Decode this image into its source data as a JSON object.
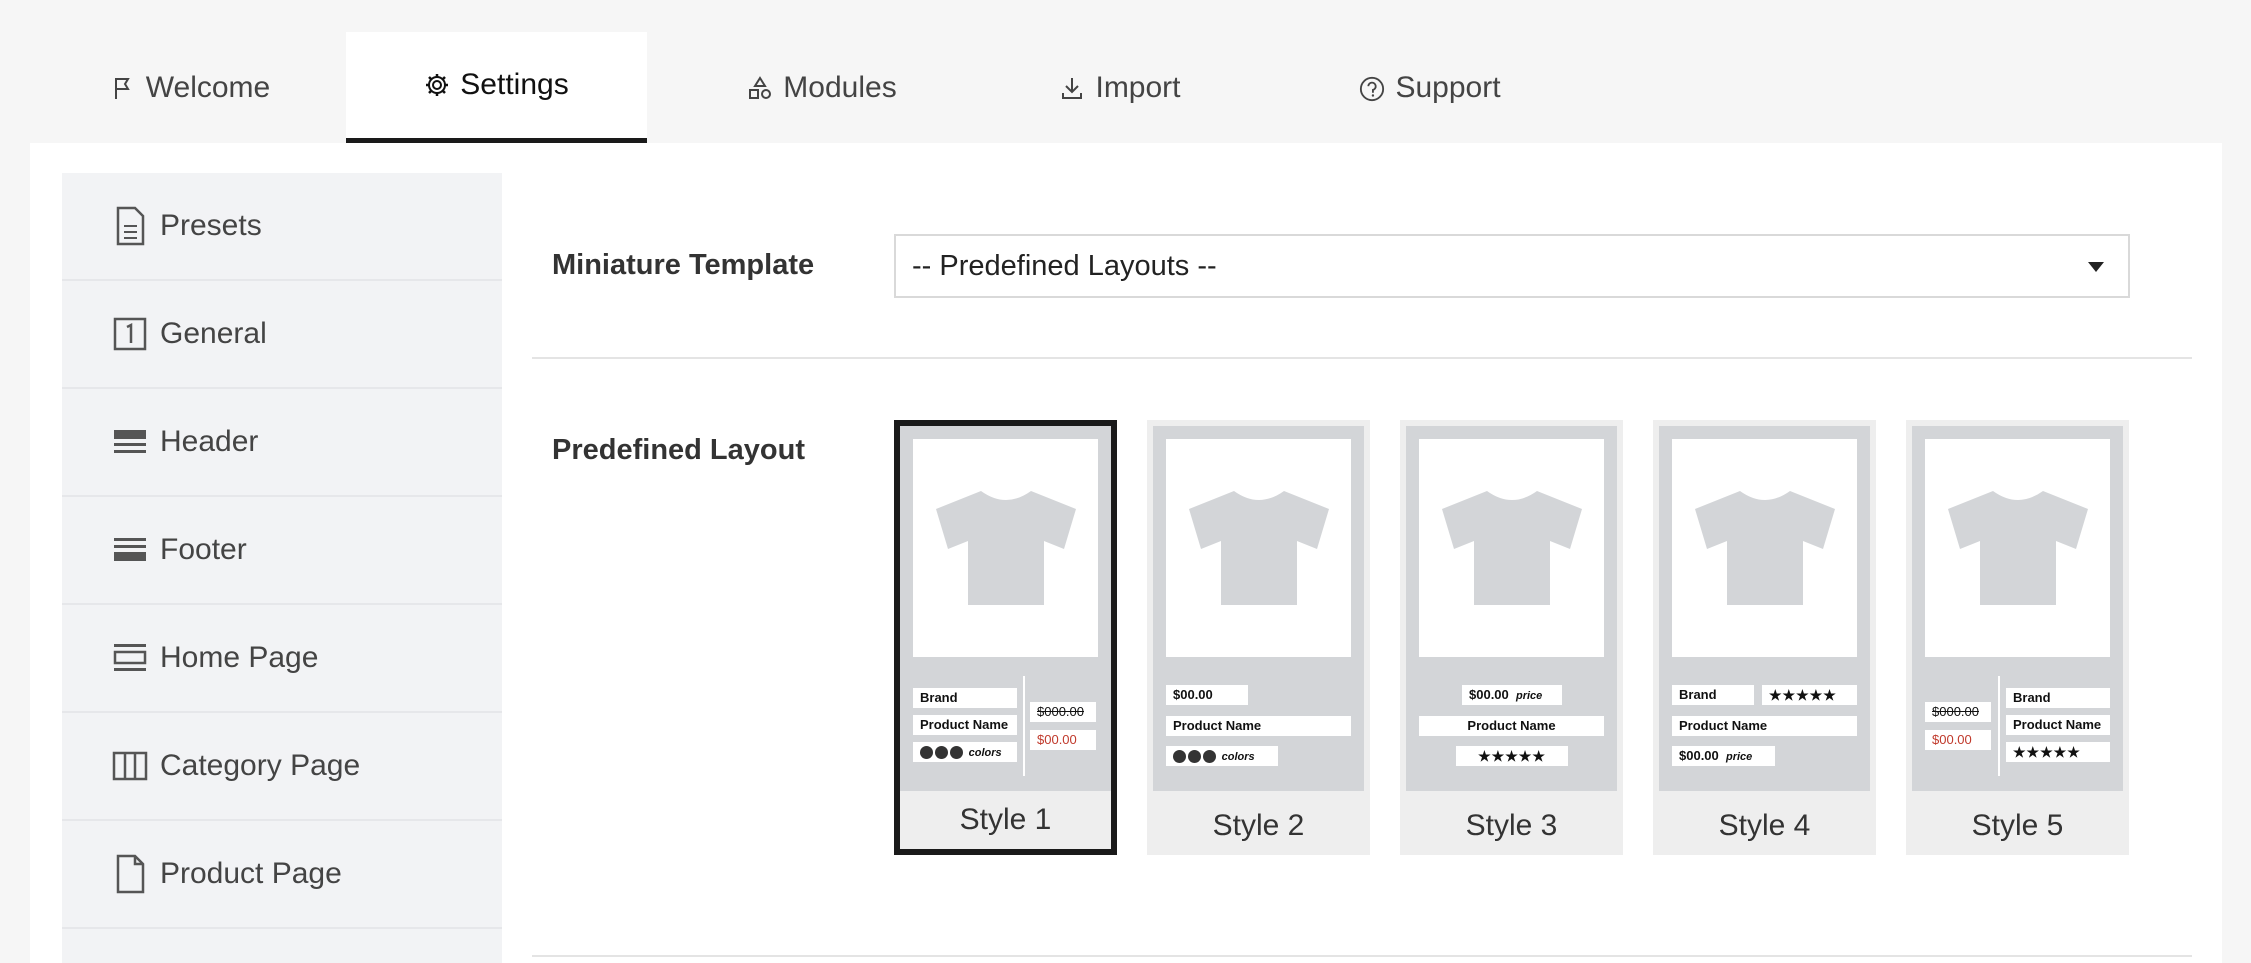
{
  "tabs": [
    {
      "label": "Welcome",
      "icon": "flag-icon"
    },
    {
      "label": "Settings",
      "icon": "gear-icon",
      "active": true
    },
    {
      "label": "Modules",
      "icon": "shapes-icon"
    },
    {
      "label": "Import",
      "icon": "download-icon"
    },
    {
      "label": "Support",
      "icon": "help-icon"
    }
  ],
  "sidebar": {
    "items": [
      {
        "label": "Presets",
        "icon": "document-icon"
      },
      {
        "label": "General",
        "icon": "number-one-icon"
      },
      {
        "label": "Header",
        "icon": "header-icon"
      },
      {
        "label": "Footer",
        "icon": "footer-icon"
      },
      {
        "label": "Home Page",
        "icon": "home-page-icon"
      },
      {
        "label": "Category Page",
        "icon": "columns-icon"
      },
      {
        "label": "Product Page",
        "icon": "file-icon"
      }
    ]
  },
  "form": {
    "miniature_label": "Miniature Template",
    "miniature_value": "-- Predefined Layouts --",
    "layout_label": "Predefined Layout"
  },
  "layouts": [
    {
      "caption": "Style 1",
      "selected": true
    },
    {
      "caption": "Style 2"
    },
    {
      "caption": "Style 3"
    },
    {
      "caption": "Style 4"
    },
    {
      "caption": "Style 5"
    }
  ],
  "mini": {
    "brand": "Brand",
    "product_name": "Product Name",
    "colors": "colors",
    "old_price": "$000.00",
    "price": "$00.00",
    "price_word": "price",
    "stars": "★★★★★"
  },
  "colors": {
    "accent": "#1a1a1a",
    "sale": "#c0392b",
    "thumb_bg": "#d3d5d8"
  }
}
